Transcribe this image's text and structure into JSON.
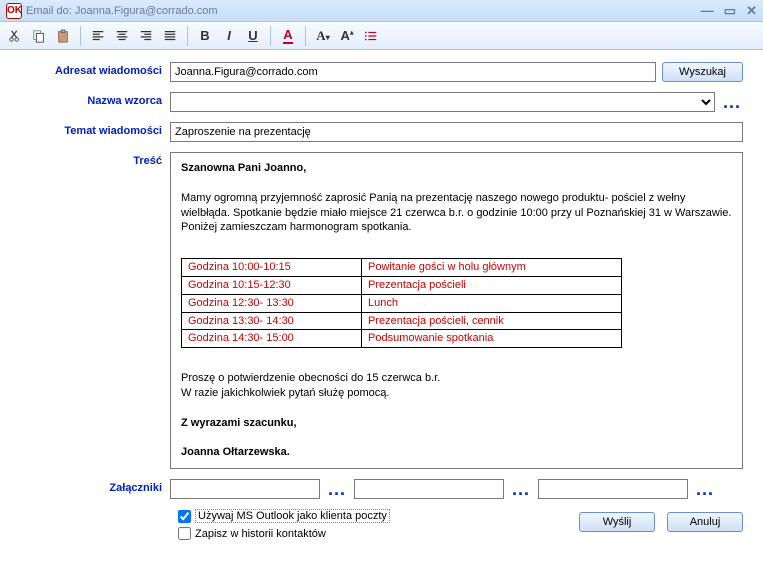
{
  "window": {
    "title": "Email do: Joanna.Figura@corrado.com"
  },
  "toolbar": {
    "cut": "✂",
    "copy": "⧉",
    "paste": "📋",
    "al": "≡",
    "ac": "≡",
    "ar": "≡",
    "aj": "≡",
    "bold": "B",
    "italic": "I",
    "underline": "U",
    "fontcolor": "A",
    "fontface": "A",
    "fontsize": "A",
    "list": "≣"
  },
  "labels": {
    "recipient": "Adresat wiadomości",
    "template": "Nazwa wzorca",
    "subject": "Temat wiadomości",
    "body": "Treść",
    "attachments": "Załączniki"
  },
  "fields": {
    "recipient": "Joanna.Figura@corrado.com",
    "template": "",
    "subject": "Zaproszenie na prezentację"
  },
  "buttons": {
    "search": "Wyszukaj",
    "send": "Wyślij",
    "cancel": "Anuluj"
  },
  "checkboxes": {
    "outlook": {
      "label": "Używaj MS Outlook jako klienta poczty",
      "checked": true
    },
    "history": {
      "label": "Zapisz w historii kontaktów",
      "checked": false
    }
  },
  "body": {
    "greeting": "Szanowna Pani Joanno,",
    "p1": "Mamy ogromną przyjemność zaprosić Panią na prezentację naszego nowego produktu- pościel z wełny wielbłąda. Spotkanie będzie miało miejsce 21 czerwca b.r. o godzinie 10:00 przy ul Poznańskiej 31 w Warszawie.",
    "p2": "Poniżej zamieszczam harmonogram spotkania.",
    "schedule": [
      {
        "time": "Godzina 10:00-10:15",
        "desc": "Powitanie gości w holu głównym"
      },
      {
        "time": "Godzina 10:15-12:30",
        "desc": "Prezentacja pościeli"
      },
      {
        "time": "Godzina 12:30- 13:30",
        "desc": "Lunch"
      },
      {
        "time": "Godzina 13:30- 14:30",
        "desc": "Prezentacja pościeli, cennik"
      },
      {
        "time": "Godzina 14:30- 15:00",
        "desc": "Podsumowanie spotkania"
      }
    ],
    "p3": "Proszę o potwierdzenie obecności do 15 czerwca b.r.",
    "p4": "W razie jakichkolwiek pytań służę pomocą.",
    "closing": "Z wyrazami szacunku,",
    "signature": "Joanna Ołtarzewska."
  }
}
